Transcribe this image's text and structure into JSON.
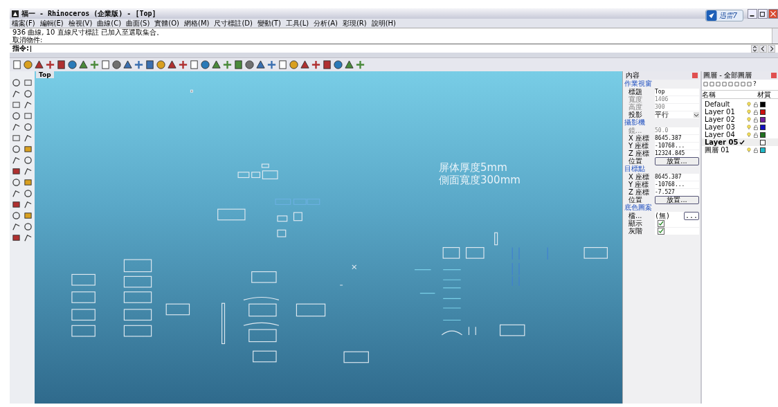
{
  "window": {
    "title": "福一 - Rhinoceros (企業版) - [Top]",
    "badge": "迅雷7"
  },
  "menu": [
    "檔案(F)",
    "編輯(E)",
    "檢視(V)",
    "曲線(C)",
    "曲面(S)",
    "實體(O)",
    "網格(M)",
    "尺寸標註(D)",
    "變動(T)",
    "工具(L)",
    "分析(A)",
    "彩現(R)",
    "說明(H)"
  ],
  "command_history": [
    "936 曲線, 10 直線尺寸標註 已加入至選取集合。",
    "取消物件:"
  ],
  "command_prompt": {
    "label": "指令:"
  },
  "viewport": {
    "tab": "Top",
    "labels": [
      "屏体厚度5mm",
      "側面寬度300mm"
    ]
  },
  "properties": {
    "title": "內容",
    "sections": [
      {
        "title": "作業視窗",
        "rows": [
          {
            "label": "標題",
            "value": "Top",
            "kind": "text",
            "disabled": false
          },
          {
            "label": "寬度",
            "value": "1406",
            "kind": "text",
            "disabled": true
          },
          {
            "label": "高度",
            "value": "300",
            "kind": "text",
            "disabled": true
          },
          {
            "label": "投影",
            "value": "平行",
            "kind": "dropdown",
            "disabled": false
          }
        ]
      },
      {
        "title": "攝影機",
        "rows": [
          {
            "label": "鏡...",
            "value": "50.0",
            "kind": "text",
            "disabled": true
          },
          {
            "label": "X 座標",
            "value": "8645.387",
            "kind": "text",
            "disabled": false
          },
          {
            "label": "Y 座標",
            "value": "-10768...",
            "kind": "text",
            "disabled": false
          },
          {
            "label": "Z 座標",
            "value": "12324.845",
            "kind": "text",
            "disabled": false
          },
          {
            "label": "位置",
            "value": "放置...",
            "kind": "button",
            "disabled": false
          }
        ]
      },
      {
        "title": "目標點",
        "rows": [
          {
            "label": "X 座標",
            "value": "8645.387",
            "kind": "text",
            "disabled": false
          },
          {
            "label": "Y 座標",
            "value": "-10768...",
            "kind": "text",
            "disabled": false
          },
          {
            "label": "Z 座標",
            "value": "-7.527",
            "kind": "text",
            "disabled": false
          },
          {
            "label": "位置",
            "value": "放置...",
            "kind": "button",
            "disabled": false
          }
        ]
      },
      {
        "title": "底色圖案",
        "rows": [
          {
            "label": "檔...",
            "value": "(無)",
            "kind": "browse",
            "button": "...",
            "disabled": false
          },
          {
            "label": "顯示",
            "kind": "checkbox",
            "checked": true,
            "disabled": false
          },
          {
            "label": "灰階",
            "kind": "checkbox",
            "checked": true,
            "disabled": false
          }
        ]
      }
    ]
  },
  "layers": {
    "title": "圖層 - 全部圖層",
    "help": "?",
    "columns": [
      "名稱",
      "材質"
    ],
    "rows": [
      {
        "name": "Default",
        "current": false,
        "color": "#000000"
      },
      {
        "name": "Layer 01",
        "current": false,
        "color": "#cc1010"
      },
      {
        "name": "Layer 02",
        "current": false,
        "color": "#7020a0"
      },
      {
        "name": "Layer 03",
        "current": false,
        "color": "#1010c0"
      },
      {
        "name": "Layer 04",
        "current": false,
        "color": "#207020"
      },
      {
        "name": "Layer 05",
        "current": true,
        "color": "#ffffff"
      },
      {
        "name": "圖層 01",
        "current": false,
        "color": "#20b8c8"
      }
    ]
  }
}
